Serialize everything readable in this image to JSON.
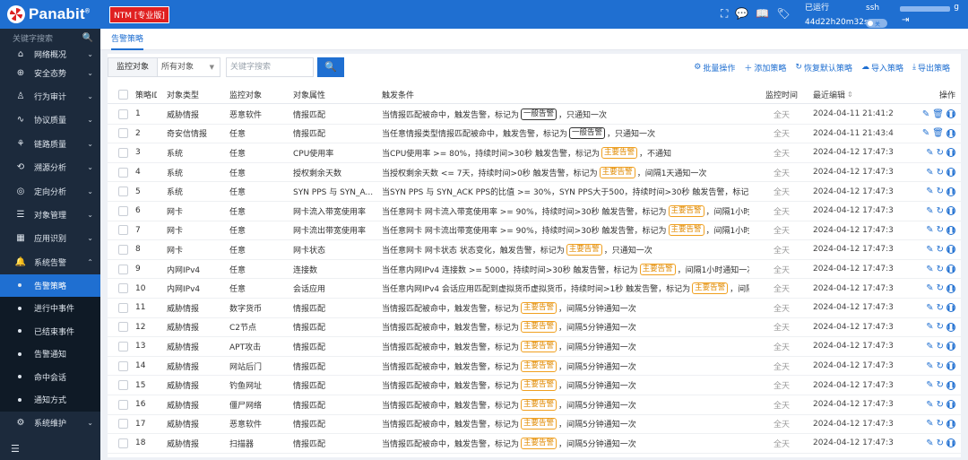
{
  "header": {
    "logo_text": "Panabit",
    "edition": "NTM [专业版]",
    "status_label": "已运行",
    "uptime": "44d22h20m32s",
    "ssh_label": "ssh",
    "ssh_toggle": "关",
    "user_tail": "g",
    "icons": [
      "expand-icon",
      "chat-icon",
      "book-icon",
      "tag-icon",
      "logout-icon"
    ]
  },
  "sidebar": {
    "search_placeholder": "关键字搜索",
    "items": [
      {
        "label": "网络概况",
        "icon": "home-icon"
      },
      {
        "label": "安全态势",
        "icon": "globe-icon"
      },
      {
        "label": "行为审计",
        "icon": "user-icon"
      },
      {
        "label": "协议质量",
        "icon": "pulse-icon"
      },
      {
        "label": "链路质量",
        "icon": "link-icon"
      },
      {
        "label": "溯源分析",
        "icon": "trace-icon"
      },
      {
        "label": "定向分析",
        "icon": "location-icon"
      },
      {
        "label": "对象管理",
        "icon": "database-icon"
      },
      {
        "label": "应用识别",
        "icon": "apps-icon"
      },
      {
        "label": "系统告警",
        "icon": "bell-icon"
      }
    ],
    "subitems": [
      "告警策略",
      "进行中事件",
      "已结束事件",
      "告警通知",
      "命中会话",
      "通知方式"
    ],
    "bottom_item": {
      "label": "系统维护",
      "icon": "settings-icon"
    }
  },
  "tabs": [
    "告警策略"
  ],
  "toolbar": {
    "filter_label": "监控对象",
    "filter_value": "所有对象",
    "search_placeholder": "关键字搜索",
    "actions": [
      {
        "label": "批量操作",
        "icon": "batch-icon"
      },
      {
        "label": "添加策略",
        "icon": "plus-icon"
      },
      {
        "label": "恢复默认策略",
        "icon": "restore-icon"
      },
      {
        "label": "导入策略",
        "icon": "upload-icon"
      },
      {
        "label": "导出策略",
        "icon": "download-icon"
      }
    ]
  },
  "table": {
    "headers": {
      "id": "策略ID",
      "type": "对象类型",
      "object": "监控对象",
      "attr": "对象属性",
      "cond": "触发条件",
      "time": "监控时间",
      "edit": "最近编辑",
      "ops": "操作"
    },
    "rows": [
      {
        "id": "1",
        "type": "威胁情报",
        "object": "恶意软件",
        "attr": "情报匹配",
        "cond_pre": "当情报匹配被命中，触发告警，标记为",
        "tag": "一般告警",
        "tag_kind": "gen",
        "cond_post": "，只通知一次",
        "time": "全天",
        "edit": "2024-04-11 21:41:25"
      },
      {
        "id": "2",
        "type": "奇安信情报",
        "object": "任意",
        "attr": "情报匹配",
        "cond_pre": "当任意情报类型情报匹配被命中，触发告警，标记为",
        "tag": "一般告警",
        "tag_kind": "gen",
        "cond_post": "，只通知一次",
        "time": "全天",
        "edit": "2024-04-11 21:43:40"
      },
      {
        "id": "3",
        "type": "系统",
        "object": "任意",
        "attr": "CPU使用率",
        "cond_pre": "当CPU使用率 >= 80%，持续时间>30秒 触发告警，标记为",
        "tag": "主要告警",
        "tag_kind": "main",
        "cond_post": "，不通知",
        "time": "全天",
        "edit": "2024-04-12 17:47:35"
      },
      {
        "id": "4",
        "type": "系统",
        "object": "任意",
        "attr": "授权剩余天数",
        "cond_pre": "当授权剩余天数 <= 7天，持续时间>0秒 触发告警，标记为",
        "tag": "主要告警",
        "tag_kind": "main",
        "cond_post": "，间隔1天通知一次",
        "time": "全天",
        "edit": "2024-04-12 17:47:35"
      },
      {
        "id": "5",
        "type": "系统",
        "object": "任意",
        "attr": "SYN PPS 与 SYN_A...",
        "cond_pre": "当SYN PPS 与 SYN_ACK PPS的比值 >= 30%，SYN PPS大于500，持续时间>30秒 触发告警，标记为...",
        "tag": "",
        "tag_kind": "",
        "cond_post": "",
        "time": "全天",
        "edit": "2024-04-12 17:47:35"
      },
      {
        "id": "6",
        "type": "网卡",
        "object": "任意",
        "attr": "网卡流入带宽使用率",
        "cond_pre": "当任意网卡 网卡流入带宽使用率 >= 90%，持续时间>30秒 触发告警，标记为",
        "tag": "主要告警",
        "tag_kind": "main",
        "cond_post": "，间隔1小时通知一次",
        "time": "全天",
        "edit": "2024-04-12 17:47:35"
      },
      {
        "id": "7",
        "type": "网卡",
        "object": "任意",
        "attr": "网卡流出带宽使用率",
        "cond_pre": "当任意网卡 网卡流出带宽使用率 >= 90%，持续时间>30秒 触发告警，标记为",
        "tag": "主要告警",
        "tag_kind": "main",
        "cond_post": "，间隔1小时通知一次",
        "time": "全天",
        "edit": "2024-04-12 17:47:35"
      },
      {
        "id": "8",
        "type": "网卡",
        "object": "任意",
        "attr": "网卡状态",
        "cond_pre": "当任意网卡 网卡状态 状态变化，触发告警，标记为",
        "tag": "主要告警",
        "tag_kind": "main",
        "cond_post": "，只通知一次",
        "time": "全天",
        "edit": "2024-04-12 17:47:35"
      },
      {
        "id": "9",
        "type": "内网IPv4",
        "object": "任意",
        "attr": "连接数",
        "cond_pre": "当任意内网IPv4 连接数 >= 5000，持续时间>30秒 触发告警，标记为",
        "tag": "主要告警",
        "tag_kind": "main",
        "cond_post": "，间隔1小时通知一次",
        "time": "全天",
        "edit": "2024-04-12 17:47:35"
      },
      {
        "id": "10",
        "type": "内网IPv4",
        "object": "任意",
        "attr": "会话应用",
        "cond_pre": "当任意内网IPv4 会话应用匹配到虚拟货币虚拟货币，持续时间>1秒 触发告警，标记为",
        "tag": "主要告警",
        "tag_kind": "main",
        "cond_post": "，间隔1小...",
        "time": "全天",
        "edit": "2024-04-12 17:47:35"
      },
      {
        "id": "11",
        "type": "威胁情报",
        "object": "数字货币",
        "attr": "情报匹配",
        "cond_pre": "当情报匹配被命中，触发告警，标记为",
        "tag": "主要告警",
        "tag_kind": "main",
        "cond_post": "，间隔5分钟通知一次",
        "time": "全天",
        "edit": "2024-04-12 17:47:35"
      },
      {
        "id": "12",
        "type": "威胁情报",
        "object": "C2节点",
        "attr": "情报匹配",
        "cond_pre": "当情报匹配被命中，触发告警，标记为",
        "tag": "主要告警",
        "tag_kind": "main",
        "cond_post": "，间隔5分钟通知一次",
        "time": "全天",
        "edit": "2024-04-12 17:47:35"
      },
      {
        "id": "13",
        "type": "威胁情报",
        "object": "APT攻击",
        "attr": "情报匹配",
        "cond_pre": "当情报匹配被命中，触发告警，标记为",
        "tag": "主要告警",
        "tag_kind": "main",
        "cond_post": "，间隔5分钟通知一次",
        "time": "全天",
        "edit": "2024-04-12 17:47:35"
      },
      {
        "id": "14",
        "type": "威胁情报",
        "object": "网站后门",
        "attr": "情报匹配",
        "cond_pre": "当情报匹配被命中，触发告警，标记为",
        "tag": "主要告警",
        "tag_kind": "main",
        "cond_post": "，间隔5分钟通知一次",
        "time": "全天",
        "edit": "2024-04-12 17:47:35"
      },
      {
        "id": "15",
        "type": "威胁情报",
        "object": "钓鱼网址",
        "attr": "情报匹配",
        "cond_pre": "当情报匹配被命中，触发告警，标记为",
        "tag": "主要告警",
        "tag_kind": "main",
        "cond_post": "，间隔5分钟通知一次",
        "time": "全天",
        "edit": "2024-04-12 17:47:35"
      },
      {
        "id": "16",
        "type": "威胁情报",
        "object": "僵尸网络",
        "attr": "情报匹配",
        "cond_pre": "当情报匹配被命中，触发告警，标记为",
        "tag": "主要告警",
        "tag_kind": "main",
        "cond_post": "，间隔5分钟通知一次",
        "time": "全天",
        "edit": "2024-04-12 17:47:35"
      },
      {
        "id": "17",
        "type": "威胁情报",
        "object": "恶意软件",
        "attr": "情报匹配",
        "cond_pre": "当情报匹配被命中，触发告警，标记为",
        "tag": "主要告警",
        "tag_kind": "main",
        "cond_post": "，间隔5分钟通知一次",
        "time": "全天",
        "edit": "2024-04-12 17:47:35"
      },
      {
        "id": "18",
        "type": "威胁情报",
        "object": "扫描器",
        "attr": "情报匹配",
        "cond_pre": "当情报匹配被命中，触发告警，标记为",
        "tag": "主要告警",
        "tag_kind": "main",
        "cond_post": "，间隔5分钟通知一次",
        "time": "全天",
        "edit": "2024-04-12 17:47:35"
      }
    ]
  },
  "colors": {
    "primary": "#1f6fd1",
    "sidebar": "#1c2a3c",
    "tag_main": "#f0a020"
  }
}
